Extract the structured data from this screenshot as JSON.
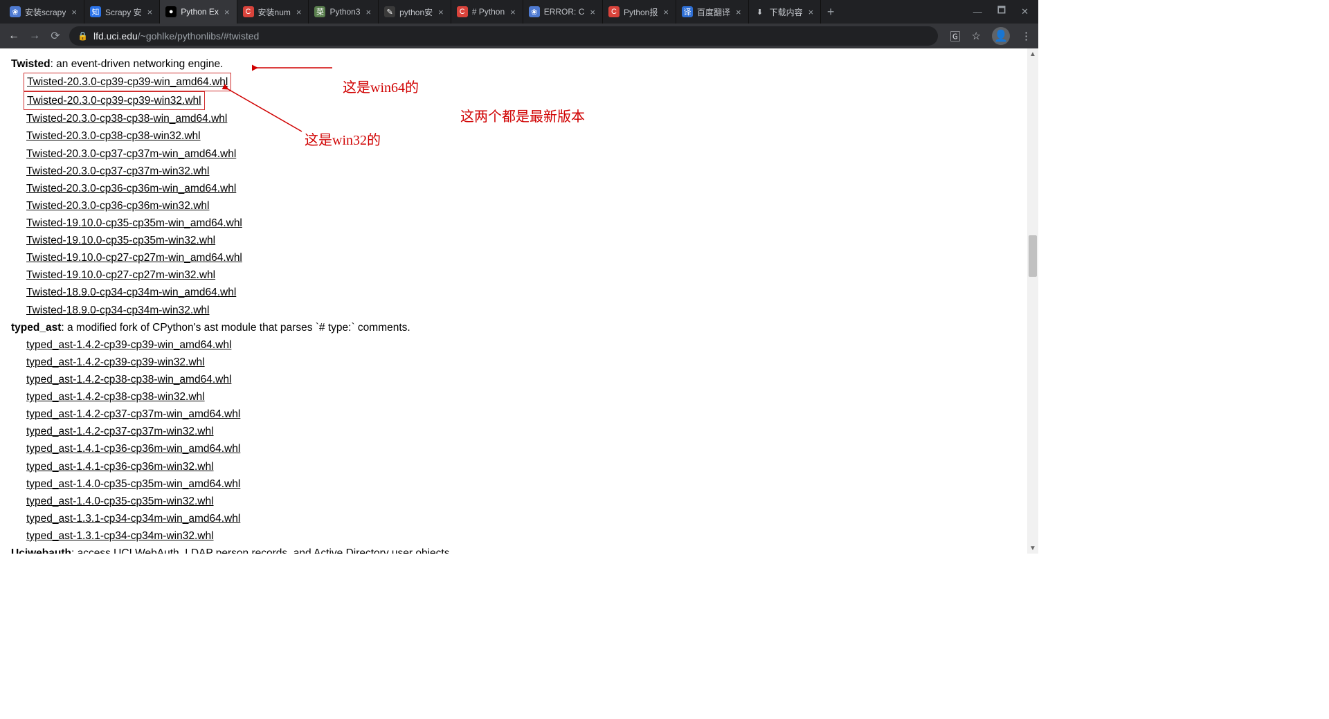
{
  "tabs": [
    {
      "title": "安装scrapy",
      "favicon_bg": "#4e7ad1",
      "favicon_txt": "❀",
      "active": false
    },
    {
      "title": "Scrapy 安",
      "favicon_bg": "#2a72e8",
      "favicon_txt": "知",
      "active": false
    },
    {
      "title": "Python Ex",
      "favicon_bg": "#000000",
      "favicon_txt": "●",
      "active": true
    },
    {
      "title": "安装num",
      "favicon_bg": "#d9433b",
      "favicon_txt": "C",
      "active": false
    },
    {
      "title": "Python3",
      "favicon_bg": "#5a7f4e",
      "favicon_txt": "菜",
      "active": false
    },
    {
      "title": "python安",
      "favicon_bg": "#3a3a3a",
      "favicon_txt": "✎",
      "active": false
    },
    {
      "title": "# Python",
      "favicon_bg": "#d9433b",
      "favicon_txt": "C",
      "active": false
    },
    {
      "title": "ERROR: C",
      "favicon_bg": "#4e7ad1",
      "favicon_txt": "❀",
      "active": false
    },
    {
      "title": "Python报",
      "favicon_bg": "#d9433b",
      "favicon_txt": "C",
      "active": false
    },
    {
      "title": "百度翻译",
      "favicon_bg": "#2f6fd4",
      "favicon_txt": "译",
      "active": false
    },
    {
      "title": "下载内容",
      "favicon_bg": "",
      "favicon_txt": "⬇",
      "active": false
    }
  ],
  "omnibox": {
    "domain": "lfd.uci.edu",
    "path": "/~gohlke/pythonlibs/#twisted"
  },
  "sections": [
    {
      "name": "Twisted",
      "desc": ": an event-driven networking engine.",
      "files": [
        "Twisted-20.3.0-cp39-cp39-win_amd64.whl",
        "Twisted-20.3.0-cp39-cp39-win32.whl",
        "Twisted-20.3.0-cp38-cp38-win_amd64.whl",
        "Twisted-20.3.0-cp38-cp38-win32.whl",
        "Twisted-20.3.0-cp37-cp37m-win_amd64.whl",
        "Twisted-20.3.0-cp37-cp37m-win32.whl",
        "Twisted-20.3.0-cp36-cp36m-win_amd64.whl",
        "Twisted-20.3.0-cp36-cp36m-win32.whl",
        "Twisted-19.10.0-cp35-cp35m-win_amd64.whl",
        "Twisted-19.10.0-cp35-cp35m-win32.whl",
        "Twisted-19.10.0-cp27-cp27m-win_amd64.whl",
        "Twisted-19.10.0-cp27-cp27m-win32.whl",
        "Twisted-18.9.0-cp34-cp34m-win_amd64.whl",
        "Twisted-18.9.0-cp34-cp34m-win32.whl"
      ],
      "boxed_indices": [
        0,
        1
      ]
    },
    {
      "name": "typed_ast",
      "desc": ": a modified fork of CPython's ast module that parses `# type:` comments.",
      "files": [
        "typed_ast-1.4.2-cp39-cp39-win_amd64.whl",
        "typed_ast-1.4.2-cp39-cp39-win32.whl",
        "typed_ast-1.4.2-cp38-cp38-win_amd64.whl",
        "typed_ast-1.4.2-cp38-cp38-win32.whl",
        "typed_ast-1.4.2-cp37-cp37m-win_amd64.whl",
        "typed_ast-1.4.2-cp37-cp37m-win32.whl",
        "typed_ast-1.4.1-cp36-cp36m-win_amd64.whl",
        "typed_ast-1.4.1-cp36-cp36m-win32.whl",
        "typed_ast-1.4.0-cp35-cp35m-win_amd64.whl",
        "typed_ast-1.4.0-cp35-cp35m-win32.whl",
        "typed_ast-1.3.1-cp34-cp34m-win_amd64.whl",
        "typed_ast-1.3.1-cp34-cp34m-win32.whl"
      ],
      "boxed_indices": []
    },
    {
      "name": "Uciwebauth",
      "desc": ": access UCI WebAuth, LDAP person records, and Active Directory user objects.",
      "files": [],
      "boxed_indices": []
    }
  ],
  "annotations": {
    "win64": "这是win64的",
    "win32": "这是win32的",
    "latest": "这两个都是最新版本"
  }
}
